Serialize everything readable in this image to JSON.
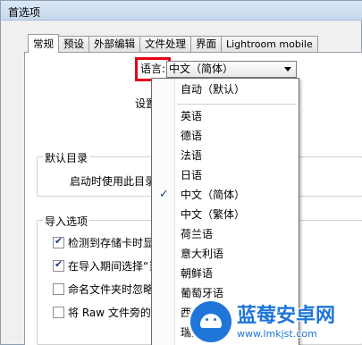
{
  "window": {
    "title": "首选项"
  },
  "tabs": [
    {
      "label": "常规",
      "active": true
    },
    {
      "label": "预设"
    },
    {
      "label": "外部编辑"
    },
    {
      "label": "文件处理"
    },
    {
      "label": "界面"
    },
    {
      "label": "Lightroom mobile"
    }
  ],
  "general": {
    "language_label": "语言:",
    "language_value": "中文（简体）",
    "settings_label": "设置"
  },
  "default_catalog": {
    "title": "默认目录",
    "startup_label": "启动时使用此目录"
  },
  "import_options": {
    "title": "导入选项",
    "items": [
      {
        "label": "检测到存储卡时显",
        "checked": true
      },
      {
        "label": "在导入期间选择“当",
        "checked": true
      },
      {
        "label": "命名文件夹时忽略",
        "checked": false
      },
      {
        "label": "将 Raw 文件旁的 .",
        "checked": false
      }
    ]
  },
  "language_menu": {
    "selected": "中文（简体）",
    "options": [
      "自动（默认）",
      "英语",
      "德语",
      "法语",
      "日语",
      "中文（简体）",
      "中文（繁体）",
      "荷兰语",
      "意大利语",
      "朝鲜语",
      "葡萄牙语",
      "西班牙语",
      "瑞典语"
    ]
  },
  "watermark": {
    "name": "蓝莓安卓网",
    "url": "www.lmkjst.com",
    "icon": "android-icon"
  },
  "colors": {
    "highlight_box": "#e60012",
    "watermark_blue": "#1f75d8"
  }
}
